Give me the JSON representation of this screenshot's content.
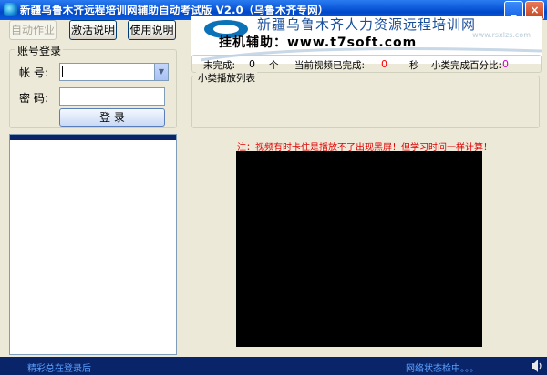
{
  "window": {
    "title": "新疆乌鲁木齐远程培训网辅助自动考试版 V2.0（乌鲁木齐专网）",
    "min_label": "_",
    "close_label": "×"
  },
  "toolbar": {
    "auto_label": "自动作业",
    "activate_label": "激活说明",
    "usage_label": "使用说明"
  },
  "login": {
    "group_label": "账号登录",
    "account_label": "帐  号:",
    "account_value": "",
    "password_label": "密  码:",
    "password_value": "",
    "login_label": "登     录"
  },
  "banner": {
    "line1": "新疆乌鲁木齐人力资源远程培训网",
    "line2": "挂机辅助：www.t7soft.com",
    "sub": "www.rsxlzs.com"
  },
  "stats": {
    "incomplete_label": "未完成:",
    "incomplete_value": "0",
    "unit_count": "个",
    "video_done_label": "当前视频已完成:",
    "video_done_value": "0",
    "unit_sec": "秒",
    "percent_label": "小类完成百分比:",
    "percent_value": "0"
  },
  "playlist": {
    "group_label": "小类播放列表"
  },
  "note": "注：视频有时卡住是播放不了出现黑屏！但学习时间一样计算！",
  "status": {
    "left": "精彩总在登录后",
    "right": "网络状态检中。。。"
  },
  "colors": {
    "title_bar": "#0a56d8",
    "status_bar": "#0a246a",
    "note_text": "#e00000",
    "count_red": "#ff0000",
    "count_magenta": "#cc00cc",
    "banner_line1": "#1a4f9c",
    "banner_line2": "#000000",
    "video_bg": "#000000"
  }
}
